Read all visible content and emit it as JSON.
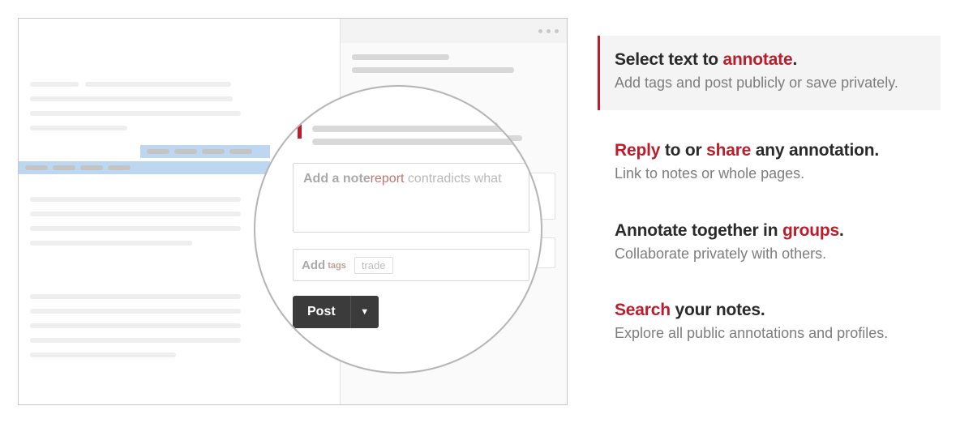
{
  "colors": {
    "accent": "#bd1c2b"
  },
  "lens": {
    "note_placeholder_a": "Add a note",
    "note_placeholder_b": "report",
    "note_placeholder_c": " contradicts what",
    "tags_placeholder": "Add",
    "tags_placeholder_sub": " tags",
    "tag_chip": "trade",
    "post_label": "Post"
  },
  "features": [
    {
      "pre": "Select text to ",
      "em": "annotate",
      "post": ".",
      "sub": "Add tags and post publicly or save privately."
    },
    {
      "em": "Reply",
      "mid": " to or ",
      "em2": "share",
      "post": " any annotation.",
      "sub": "Link to notes or whole pages."
    },
    {
      "pre": "Annotate together in ",
      "em": "groups",
      "post": ".",
      "sub": "Collaborate privately with others."
    },
    {
      "em": "Search",
      "post": " your notes.",
      "sub": "Explore all public annotations and profiles."
    }
  ]
}
